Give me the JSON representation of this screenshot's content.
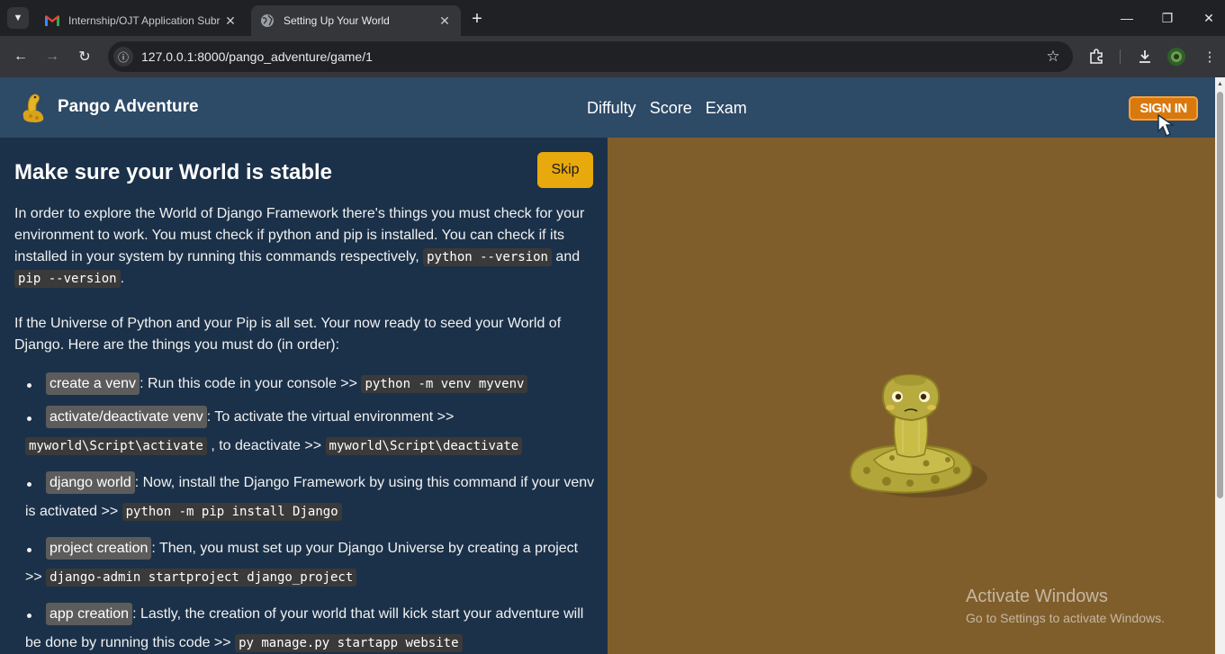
{
  "browser": {
    "tabs": [
      {
        "title": "Internship/OJT Application Subr",
        "icon": "gmail-icon",
        "active": false
      },
      {
        "title": "Setting Up Your World",
        "icon": "globe-icon",
        "active": true
      }
    ],
    "url": "127.0.0.1:8000/pango_adventure/game/1"
  },
  "navbar": {
    "brand": "Pango Adventure",
    "links": [
      "Diffulty",
      "Score",
      "Exam"
    ],
    "signin": "SIGN IN"
  },
  "content": {
    "heading": "Make sure your World is stable",
    "skip": "Skip",
    "intro": {
      "text1": "In order to explore the World of Django Framework there's things you must check for your environment to work. You must check if python and pip is installed. You can check if its installed in your system by running this commands respectively, ",
      "code1": "python --version",
      "text2": " and ",
      "code2": "pip --version",
      "text3": "."
    },
    "para2": "If the Universe of Python and your Pip is all set. Your now ready to seed your World of Django. Here are the things you must do (in order):",
    "steps": [
      {
        "tag": "create a venv",
        "text": ": Run this code in your console >> ",
        "code": "python -m venv myvenv"
      },
      {
        "tag": "activate/deactivate venv",
        "text": ": To activate the virtual environment >> ",
        "code": "myworld\\Script\\activate",
        "text2": " , to deactivate >> ",
        "code2": "myworld\\Script\\deactivate"
      },
      {
        "tag": "django world",
        "text": ": Now, install the Django Framework by using this command if your venv is activated >> ",
        "code": "python -m pip install Django"
      },
      {
        "tag": "project creation",
        "text": ": Then, you must set up your Django Universe by creating a project >> ",
        "code": "django-admin startproject django_project"
      },
      {
        "tag": "app creation",
        "text": ": Lastly, the creation of your world that will kick start your adventure will be done by running this code >> ",
        "code": "py manage.py startapp website"
      }
    ]
  },
  "watermark": {
    "title": "Activate Windows",
    "subtitle": "Go to Settings to activate Windows."
  },
  "colors": {
    "navbar": "#2d4a67",
    "left_panel": "#1b3149",
    "right_panel": "#7f5e2c",
    "skip": "#e8a90c",
    "signin": "#d9780d"
  }
}
